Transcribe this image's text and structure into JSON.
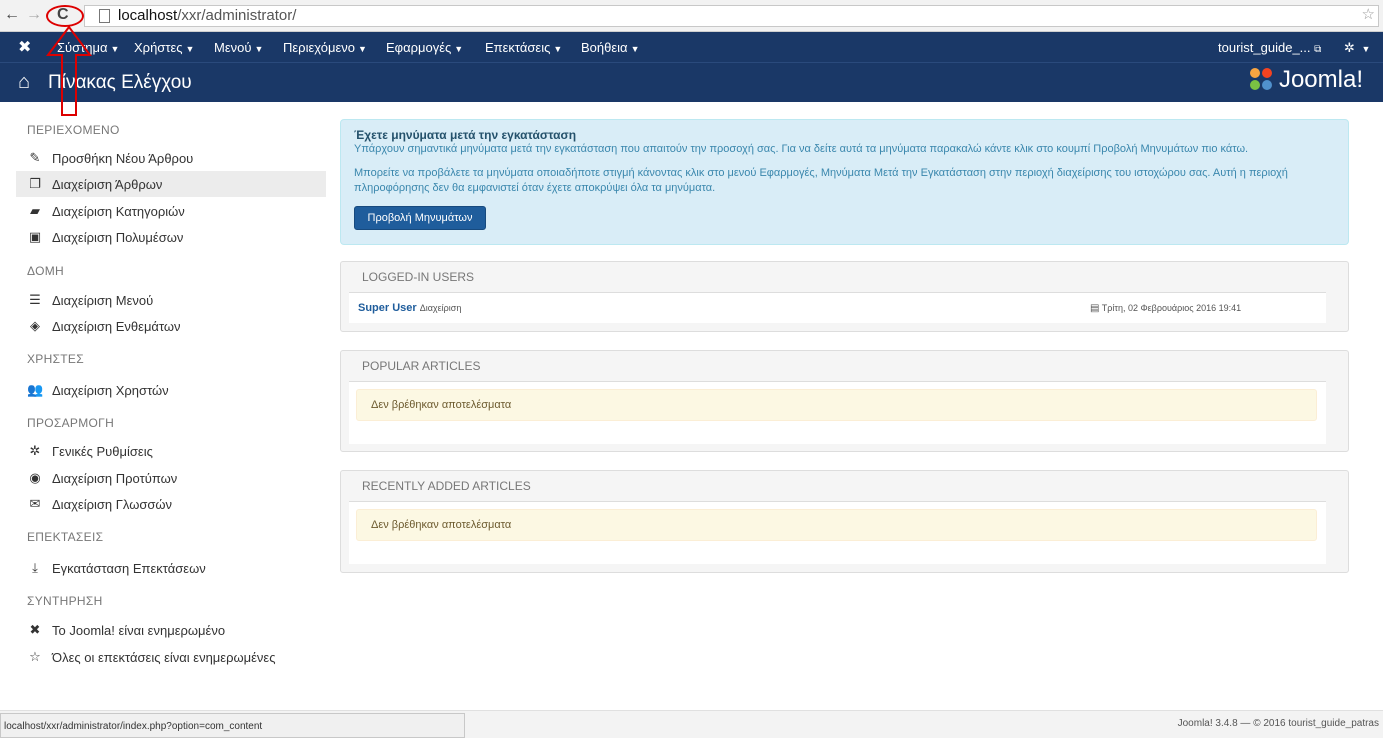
{
  "browser": {
    "url_host": "localhost",
    "url_path": "/xxr/administrator/"
  },
  "topnav": {
    "items": [
      "Σύστημα",
      "Χρήστες",
      "Μενού",
      "Περιεχόμενο",
      "Εφαρμογές",
      "Επεκτάσεις",
      "Βοήθεια"
    ],
    "user": "tourist_guide_..."
  },
  "header": {
    "title": "Πίνακας Ελέγχου",
    "logo": "Joomla!"
  },
  "sidebar": {
    "sections": [
      {
        "title": "ΠΕΡΙΕΧΟΜΕΝΟ",
        "items": [
          "Προσθήκη Νέου Άρθρου",
          "Διαχείριση Άρθρων",
          "Διαχείριση Κατηγοριών",
          "Διαχείριση Πολυμέσων"
        ]
      },
      {
        "title": "ΔΟΜΗ",
        "items": [
          "Διαχείριση Μενού",
          "Διαχείριση Ενθεμάτων"
        ]
      },
      {
        "title": "ΧΡΗΣΤΕΣ",
        "items": [
          "Διαχείριση Χρηστών"
        ]
      },
      {
        "title": "ΠΡΟΣΑΡΜΟΓΗ",
        "items": [
          "Γενικές Ρυθμίσεις",
          "Διαχείριση Προτύπων",
          "Διαχείριση Γλωσσών"
        ]
      },
      {
        "title": "ΕΠΕΚΤΑΣΕΙΣ",
        "items": [
          "Εγκατάσταση Επεκτάσεων"
        ]
      },
      {
        "title": "ΣΥΝΤΗΡΗΣΗ",
        "items": [
          "Το Joomla! είναι ενημερωμένο",
          "Όλες οι επεκτάσεις είναι ενημερωμένες"
        ]
      }
    ]
  },
  "alert": {
    "heading": "Έχετε μηνύματα μετά την εγκατάσταση",
    "line1": "Υπάρχουν σημαντικά μηνύματα μετά την εγκατάσταση που απαιτούν την προσοχή σας. Για να δείτε αυτά τα μηνύματα παρακαλώ κάντε κλικ στο κουμπί Προβολή Μηνυμάτων πιο κάτω.",
    "line2": "Μπορείτε να προβάλετε τα μηνύματα οποιαδήποτε στιγμή κάνοντας κλικ στο μενού Εφαρμογές, Μηνύματα Μετά την Εγκατάσταση στην περιοχή διαχείρισης του ιστοχώρου σας. Αυτή η περιοχή πληροφόρησης δεν θα εμφανιστεί όταν έχετε αποκρύψει όλα τα μηνύματα.",
    "button": "Προβολή Μηνυμάτων"
  },
  "logged_in": {
    "title": "LOGGED-IN USERS",
    "user": "Super User",
    "role": "Διαχείριση",
    "date": "Τρίτη, 02 Φεβρουάριος 2016 19:41"
  },
  "popular": {
    "title": "POPULAR ARTICLES",
    "empty": "Δεν βρέθηκαν αποτελέσματα"
  },
  "recent": {
    "title": "RECENTLY ADDED ARTICLES",
    "empty": "Δεν βρέθηκαν αποτελέσματα"
  },
  "status": {
    "link": "localhost/xxr/administrator/index.php?option=com_content",
    "footer": "Joomla! 3.4.8 — © 2016 tourist_guide_patras"
  }
}
